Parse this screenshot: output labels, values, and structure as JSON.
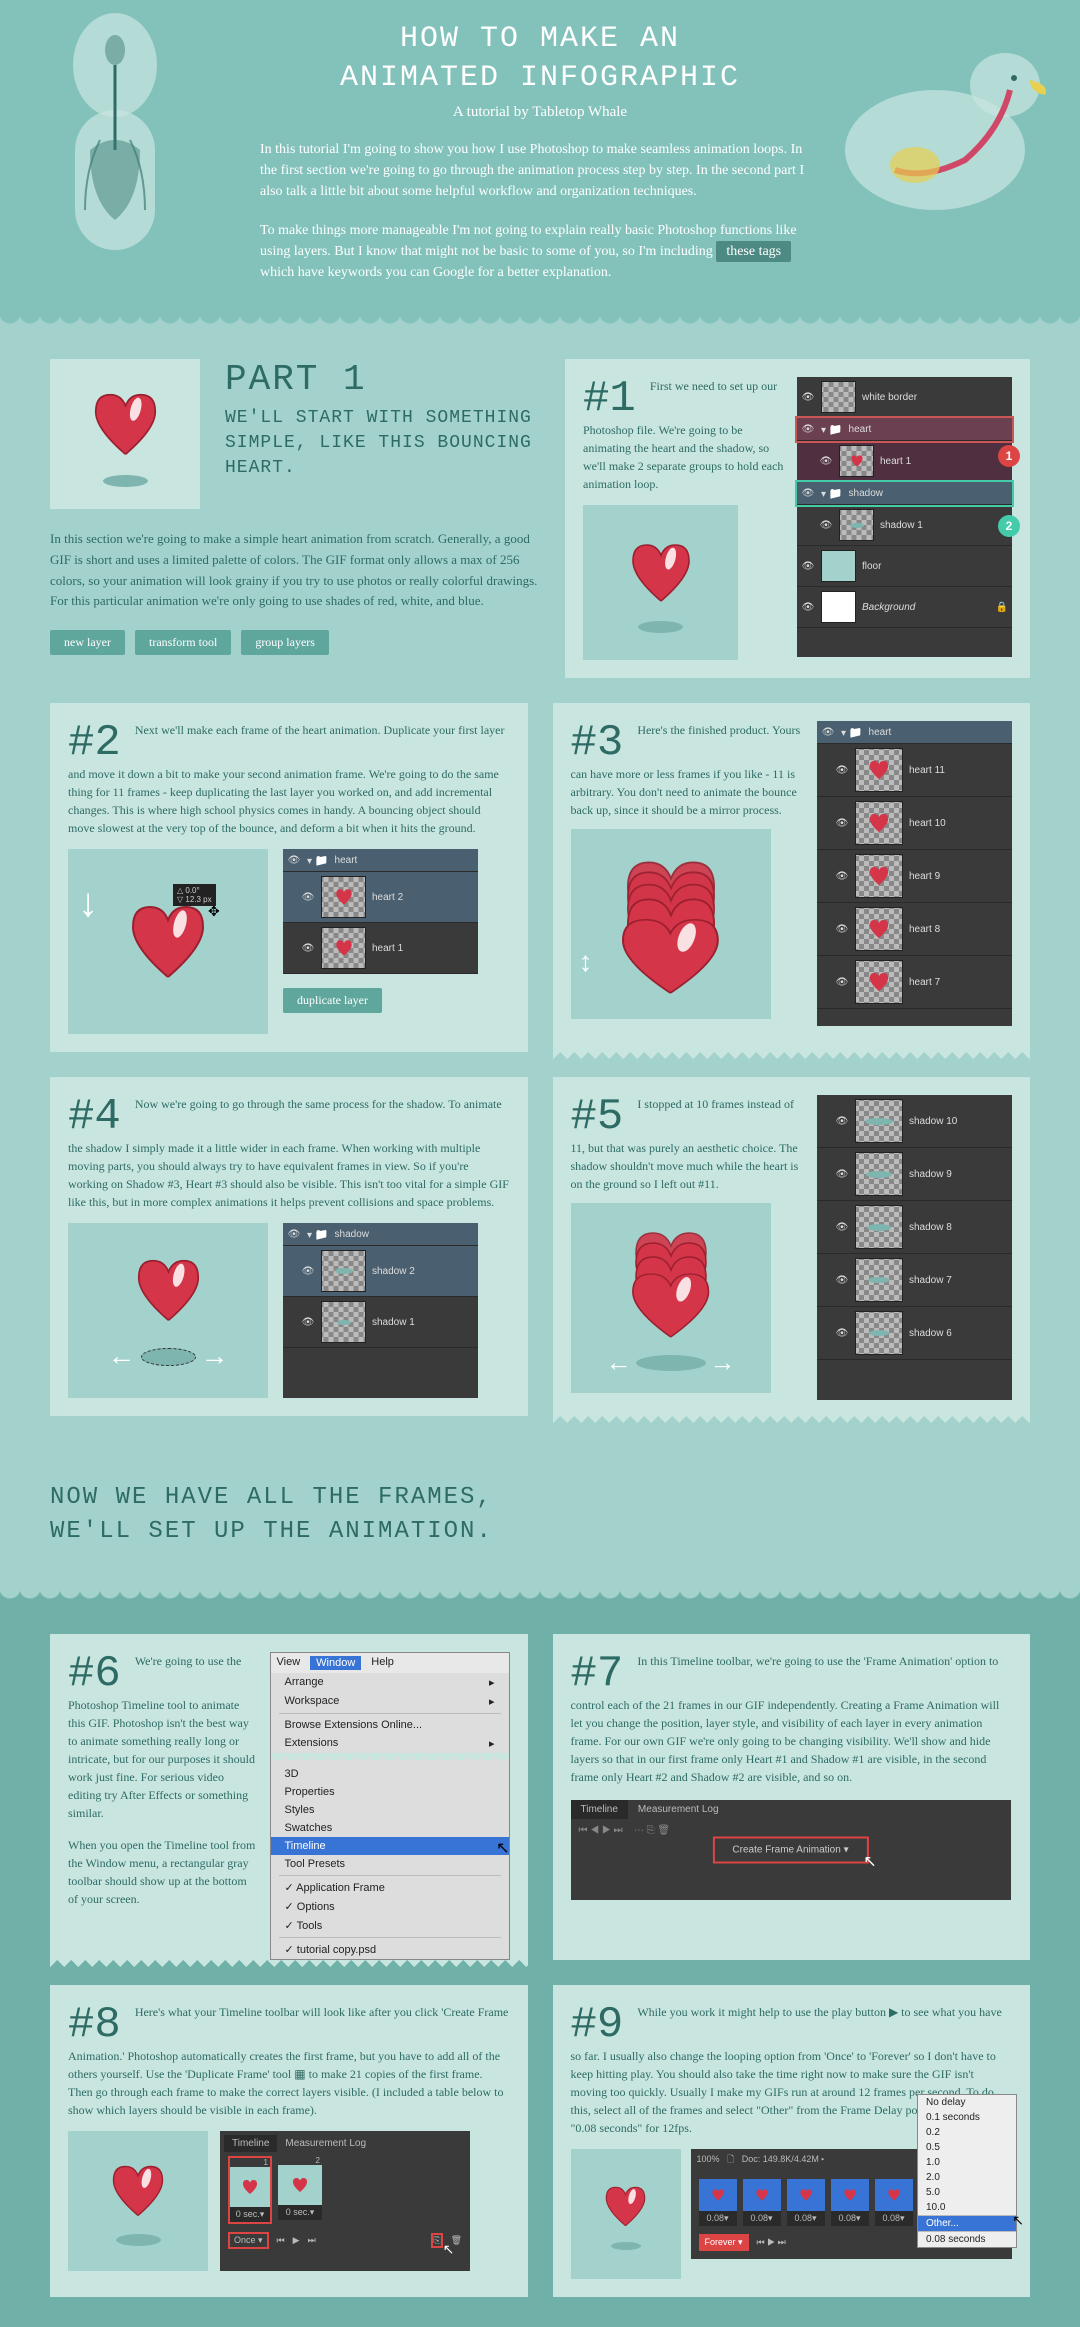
{
  "header": {
    "title_l1": "HOW TO MAKE AN",
    "title_l2": "ANIMATED INFOGRAPHIC",
    "byline": "A tutorial by Tabletop Whale",
    "p1": "In this tutorial I'm going to show you how I use Photoshop to make seamless animation loops. In the first section we're going to go through the animation process step by step. In the second part I also talk a little bit about some helpful workflow and organization techniques.",
    "p2a": "To make things more manageable I'm not going to explain really basic Photoshop functions like using layers. But I know that might not be basic to some of you, so I'm including ",
    "p2_tag": "these tags",
    "p2b": " which have keywords you can Google for a better explanation."
  },
  "part1": {
    "title": "PART 1",
    "sub": "WE'LL START WITH SOMETHING SIMPLE, LIKE THIS BOUNCING HEART.",
    "intro": "In this section we're going to make a simple heart animation from scratch. Generally, a good GIF is short and uses a limited palette of colors. The GIF format only allows a max of 256 colors, so your animation will look grainy if you try to use photos or really colorful drawings. For this particular animation we're only going to use shades of red, white, and blue.",
    "tags": [
      "new layer",
      "transform tool",
      "group layers"
    ]
  },
  "steps": {
    "s1": {
      "num": "#1",
      "text": "First we need to set up our Photoshop file. We're going to be animating the heart and the shadow, so we'll make 2 separate groups to hold each animation loop.",
      "layers": [
        "white border",
        "heart",
        "heart 1",
        "shadow",
        "shadow 1",
        "floor",
        "Background"
      ]
    },
    "s2": {
      "num": "#2",
      "text": "Next we'll make each frame of the heart animation. Duplicate your first layer and move it down a bit to make your second animation frame. We're going to do the same thing for 11 frames - keep duplicating the last layer you worked on, and add incremental changes. This is where high school physics comes in handy. A bouncing object should move slowest at the very top of the bounce, and deform a bit when it hits the ground.",
      "tag": "duplicate layer",
      "layers": [
        "heart",
        "heart 2",
        "heart 1"
      ]
    },
    "s3": {
      "num": "#3",
      "text": "Here's the finished product. Yours can have more or less frames if you like - 11 is arbitrary. You don't need to animate the bounce back up, since it should be a mirror process.",
      "layers": [
        "heart",
        "heart 11",
        "heart 10",
        "heart 9",
        "heart 8",
        "heart 7"
      ]
    },
    "s4": {
      "num": "#4",
      "text": "Now we're going to go through the same process for the shadow. To animate the shadow I simply made it a little wider in each frame. When working with multiple moving parts, you should always try to have equivalent frames in view. So if you're working on Shadow #3, Heart #3 should also be visible. This isn't too vital for a simple GIF like this, but in more complex animations it helps prevent collisions and space problems.",
      "layers": [
        "shadow",
        "shadow 2",
        "shadow 1"
      ]
    },
    "s5": {
      "num": "#5",
      "text": "I stopped at 10 frames instead of 11, but that was purely an aesthetic choice. The shadow shouldn't move much while the heart is on the ground so I left out #11.",
      "layers": [
        "shadow 10",
        "shadow 9",
        "shadow 8",
        "shadow 7",
        "shadow 6"
      ]
    }
  },
  "transition": {
    "l1": "NOW WE HAVE ALL THE FRAMES,",
    "l2": "WE'LL SET UP THE ANIMATION."
  },
  "steps2": {
    "s6": {
      "num": "#6",
      "text1": "We're going to use the Photoshop Timeline tool to animate this GIF. Photoshop isn't the best way to animate something really long or intricate, but for our purposes it should work just fine. For serious video editing try After Effects or something similar.",
      "text2": "When you open the Timeline tool from the Window menu, a rectangular gray toolbar should show up at the bottom of your screen.",
      "menu": {
        "bar": [
          "View",
          "Window",
          "Help"
        ],
        "items": [
          "Arrange",
          "Workspace",
          "",
          "Browse Extensions Online...",
          "Extensions",
          "",
          "3D",
          "Properties",
          "Styles",
          "Swatches",
          "Timeline",
          "Tool Presets",
          "",
          "✓ Application Frame",
          "✓ Options",
          "✓ Tools",
          "",
          "✓ tutorial copy.psd"
        ]
      }
    },
    "s7": {
      "num": "#7",
      "text": "In this Timeline toolbar, we're going to use the 'Frame Animation' option to control each of the 21 frames in our GIF independently. Creating a Frame Animation will let you change the position, layer style, and visibility of each layer in every animation frame. For our own GIF we're only going to be changing visibility. We'll show and hide layers so that in our first frame only Heart #1 and Shadow #1 are visible, in the second frame only Heart #2 and Shadow #2 are visible, and so on.",
      "tabs": [
        "Timeline",
        "Measurement Log"
      ],
      "btn": "Create Frame Animation"
    },
    "s8": {
      "num": "#8",
      "text": "Here's what your Timeline toolbar will look like after you click 'Create Frame Animation.' Photoshop automatically creates the first frame, but you have to add all of the others yourself. Use the 'Duplicate Frame' tool ▦ to make 21 copies of the first frame. Then go through each frame to make the correct layers visible. (I included a table below to show which layers should be visible in each frame).",
      "tabs": [
        "Timeline",
        "Measurement Log"
      ],
      "frames": [
        "1",
        "2"
      ],
      "delay": "0 sec.",
      "loop": "Once"
    },
    "s9": {
      "num": "#9",
      "text": "While you work it might help to use the play button ▶ to see what you have so far. I usually also change the looping option from 'Once' to 'Forever' so I don't have to keep hitting play. You should also take the time right now to make sure the GIF isn't moving too quickly. Usually I make my GIFs run at around 12 frames per second. To do this, select all of the frames and select \"Other\" from the Frame Delay pop-up menu. Type in \"0.08 seconds\" for 12fps.",
      "delays": [
        "No delay",
        "0.1 seconds",
        "0.2",
        "0.5",
        "1.0",
        "2.0",
        "5.0",
        "10.0",
        "Other...",
        "0.08 seconds"
      ],
      "doc_info": "Doc: 149.8K/4.42M",
      "zoom": "100%",
      "loop": "Forever",
      "frame_delay": "0.08"
    }
  }
}
